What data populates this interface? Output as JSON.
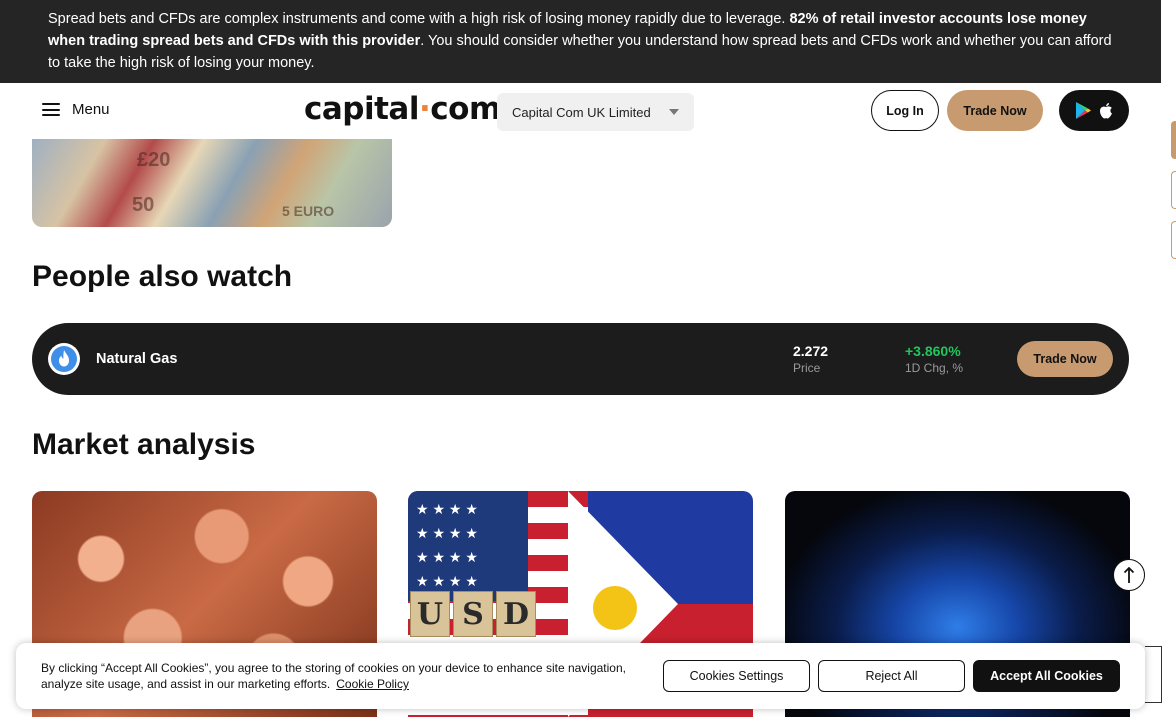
{
  "risk_banner": {
    "part1": "Spread bets and CFDs are complex instruments and come with a high risk of losing money rapidly due to leverage. ",
    "bold": "82% of retail investor accounts lose money when trading spread bets and CFDs with this provider",
    "part2": ". You should consider whether you understand how spread bets and CFDs work and whether you can afford to take the high risk of losing your money."
  },
  "header": {
    "menu_label": "Menu",
    "logo_left": "capital",
    "logo_dot": "·",
    "logo_right": "com",
    "entity_select": "Capital Com UK Limited",
    "login_label": "Log In",
    "trade_label": "Trade Now"
  },
  "people_also_watch": {
    "title": "People also watch",
    "items": [
      {
        "name": "Natural Gas",
        "price": "2.272",
        "price_label": "Price",
        "change": "+3.860%",
        "change_label": "1D Chg, %",
        "trade_label": "Trade Now"
      }
    ]
  },
  "market_analysis": {
    "title": "Market analysis",
    "usd_tiles": [
      "U",
      "S",
      "D"
    ]
  },
  "cookie_bar": {
    "text": "By clicking “Accept All Cookies”, you agree to the storing of cookies on your device to enhance site navigation, analyze site usage, and assist in our marketing efforts.",
    "policy_link": "Cookie Policy",
    "settings_label": "Cookies Settings",
    "reject_label": "Reject All",
    "accept_label": "Accept All Cookies"
  },
  "colors": {
    "accent": "#c79a6f",
    "banner_bg": "#252525",
    "positive": "#21c55d",
    "row_bg": "#1c1c1c"
  },
  "icons": [
    "menu-icon",
    "caret-down-icon",
    "google-play-icon",
    "apple-icon",
    "flame-icon",
    "arrow-up-icon"
  ]
}
